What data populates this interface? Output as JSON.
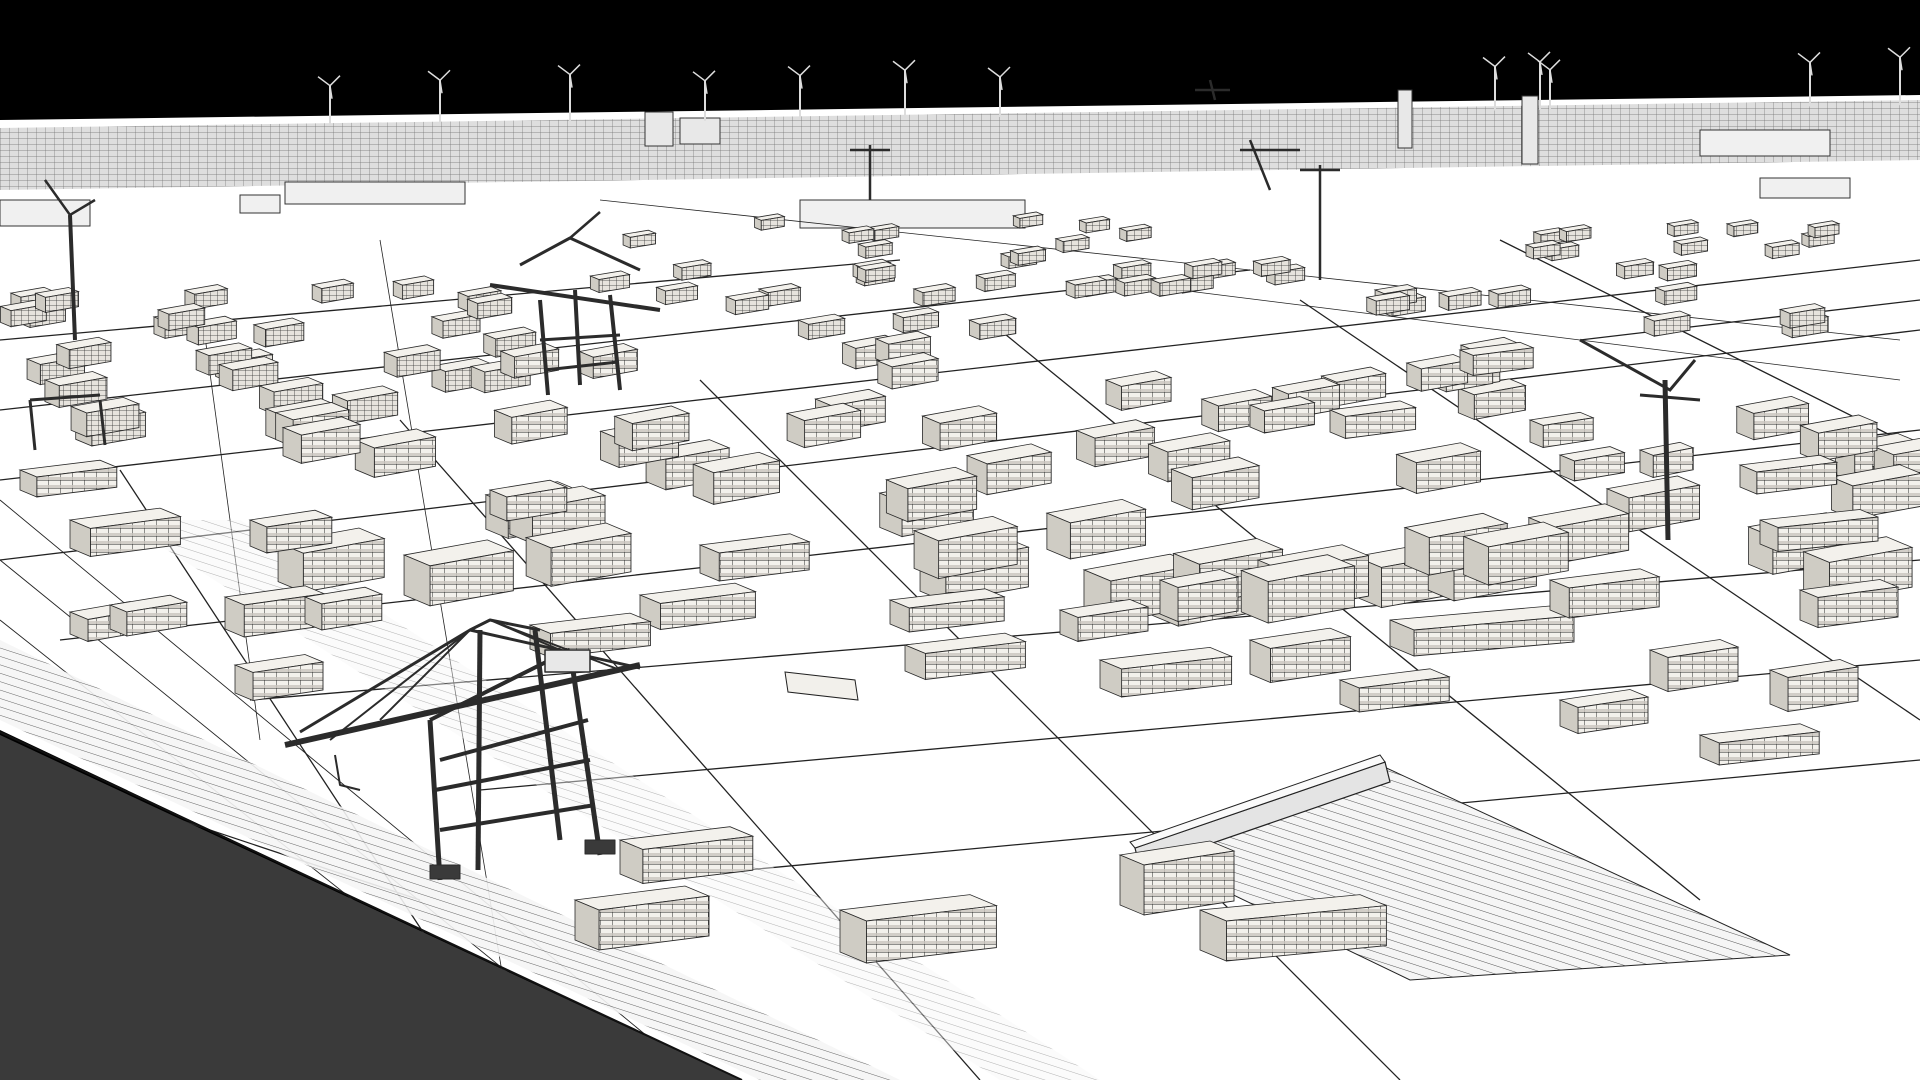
{
  "scene": {
    "subject": "port-container-terminal",
    "colors": {
      "sky": "#000000",
      "ground": "#ffffff",
      "water": "#3a3a3a",
      "line": "#1e1e1e",
      "container_top": "#f3f1ec",
      "container_side": "#cfccc4",
      "crane": "#2b2b2b"
    },
    "counts": {
      "wind_turbines": 12,
      "ship_to_shore_cranes": 4,
      "container_stacks": 180
    }
  }
}
